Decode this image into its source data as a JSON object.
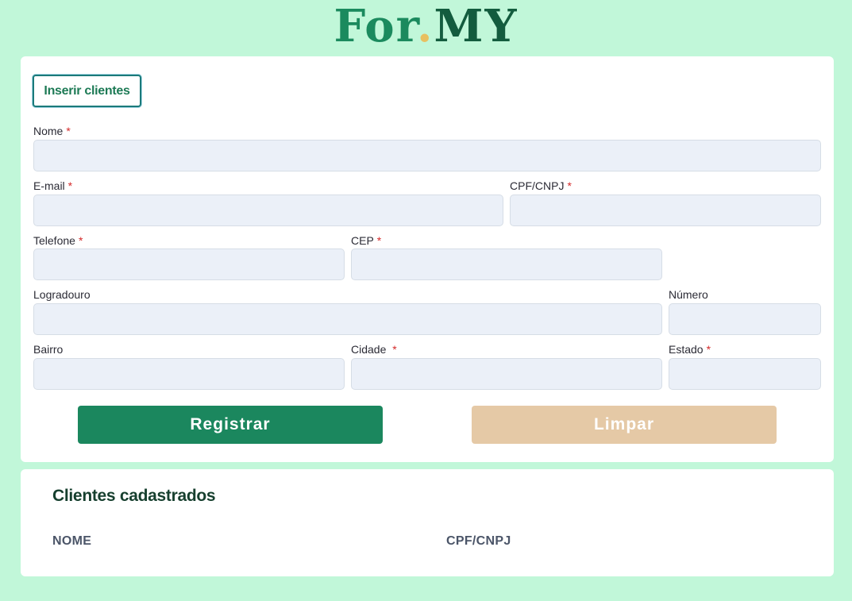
{
  "logo": {
    "part1": "For",
    "dot": ".",
    "part2": "MY"
  },
  "form": {
    "insert_tab_label": "Inserir clientes",
    "required_marker": "*",
    "fields": {
      "nome": {
        "label": "Nome",
        "value": ""
      },
      "email": {
        "label": "E-mail",
        "value": ""
      },
      "cpf_cnpj": {
        "label": "CPF/CNPJ",
        "value": ""
      },
      "telefone": {
        "label": "Telefone",
        "value": ""
      },
      "cep": {
        "label": "CEP",
        "value": ""
      },
      "logradouro": {
        "label": "Logradouro",
        "value": ""
      },
      "numero": {
        "label": "Número",
        "value": ""
      },
      "bairro": {
        "label": "Bairro",
        "value": ""
      },
      "cidade": {
        "label": "Cidade ",
        "value": ""
      },
      "estado": {
        "label": "Estado",
        "value": ""
      }
    },
    "register_label": "Registrar",
    "clear_label": "Limpar"
  },
  "clients": {
    "title": "Clientes cadastrados",
    "columns": [
      "NOME",
      "CPF/CNPJ"
    ]
  },
  "colors": {
    "page_background": "#c1f7d9",
    "primary": "#1b875e",
    "clear_button": "#e5c9a6",
    "input_background": "#ebf0f8",
    "required": "#d42a2a"
  }
}
